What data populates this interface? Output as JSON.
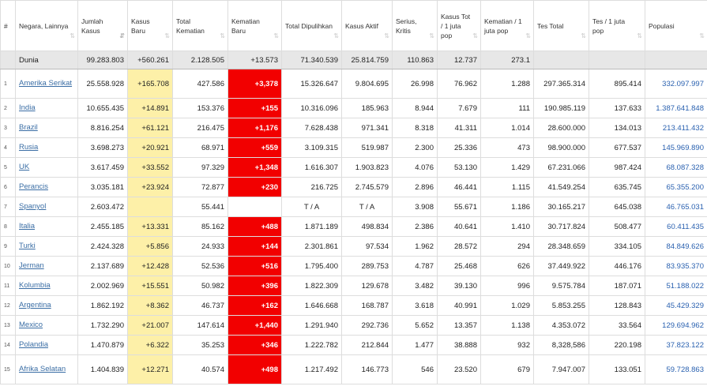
{
  "headers": [
    {
      "label": "#",
      "sort": ""
    },
    {
      "label": "Negara, Lainnya",
      "sort": "⇅"
    },
    {
      "label": "Jumlah Kasus",
      "sort": "⇵"
    },
    {
      "label": "Kasus Baru",
      "sort": "⇅"
    },
    {
      "label": "Total Kematian",
      "sort": "⇅"
    },
    {
      "label": "Kematian Baru",
      "sort": "⇅"
    },
    {
      "label": "Total Dipulihkan",
      "sort": "⇅"
    },
    {
      "label": "Kasus Aktif",
      "sort": "⇅"
    },
    {
      "label": "Serius, Kritis",
      "sort": "⇅"
    },
    {
      "label": "Kasus Tot / 1 juta pop",
      "sort": "⇅"
    },
    {
      "label": "Kematian / 1 juta pop",
      "sort": "⇅"
    },
    {
      "label": "Tes Total",
      "sort": "⇅"
    },
    {
      "label": "Tes / 1 juta pop",
      "sort": "⇅"
    },
    {
      "label": "Populasi",
      "sort": "⇅"
    }
  ],
  "world": [
    "",
    "Dunia",
    "99.283.803",
    "+560.261",
    "2.128.505",
    "+13.573",
    "71.340.539",
    "25.814.759",
    "110.863",
    "12.737",
    "273.1",
    "",
    "",
    ""
  ],
  "rows": [
    [
      "1",
      "Amerika Serikat",
      "25.558.928",
      "+165.708",
      "427.586",
      "+3,378",
      "15.326.647",
      "9.804.695",
      "26.998",
      "76.962",
      "1.288",
      "297.365.314",
      "895.414",
      "332.097.997"
    ],
    [
      "2",
      "India",
      "10.655.435",
      "+14.891",
      "153.376",
      "+155",
      "10.316.096",
      "185.963",
      "8.944",
      "7.679",
      "111",
      "190.985.119",
      "137.633",
      "1.387.641.848"
    ],
    [
      "3",
      "Brazil",
      "8.816.254",
      "+61.121",
      "216.475",
      "+1,176",
      "7.628.438",
      "971.341",
      "8.318",
      "41.311",
      "1.014",
      "28.600.000",
      "134.013",
      "213.411.432"
    ],
    [
      "4",
      "Rusia",
      "3.698.273",
      "+20.921",
      "68.971",
      "+559",
      "3.109.315",
      "519.987",
      "2.300",
      "25.336",
      "473",
      "98.900.000",
      "677.537",
      "145.969.890"
    ],
    [
      "5",
      "UK",
      "3.617.459",
      "+33.552",
      "97.329",
      "+1,348",
      "1.616.307",
      "1.903.823",
      "4.076",
      "53.130",
      "1.429",
      "67.231.066",
      "987.424",
      "68.087.328"
    ],
    [
      "6",
      "Perancis",
      "3.035.181",
      "+23.924",
      "72.877",
      "+230",
      "216.725",
      "2.745.579",
      "2.896",
      "46.441",
      "1.115",
      "41.549.254",
      "635.745",
      "65.355.200"
    ],
    [
      "7",
      "Spanyol",
      "2.603.472",
      "",
      "55.441",
      "",
      "T / A",
      "T / A",
      "3.908",
      "55.671",
      "1.186",
      "30.165.217",
      "645.038",
      "46.765.031"
    ],
    [
      "8",
      "Italia",
      "2.455.185",
      "+13.331",
      "85.162",
      "+488",
      "1.871.189",
      "498.834",
      "2.386",
      "40.641",
      "1.410",
      "30.717.824",
      "508.477",
      "60.411.435"
    ],
    [
      "9",
      "Turki",
      "2.424.328",
      "+5.856",
      "24.933",
      "+144",
      "2.301.861",
      "97.534",
      "1.962",
      "28.572",
      "294",
      "28.348.659",
      "334.105",
      "84.849.626"
    ],
    [
      "10",
      "Jerman",
      "2.137.689",
      "+12.428",
      "52.536",
      "+516",
      "1.795.400",
      "289.753",
      "4.787",
      "25.468",
      "626",
      "37.449.922",
      "446.176",
      "83.935.370"
    ],
    [
      "11",
      "Kolumbia",
      "2.002.969",
      "+15.551",
      "50.982",
      "+396",
      "1.822.309",
      "129.678",
      "3.482",
      "39.130",
      "996",
      "9.575.784",
      "187.071",
      "51.188.022"
    ],
    [
      "12",
      "Argentina",
      "1.862.192",
      "+8.362",
      "46.737",
      "+162",
      "1.646.668",
      "168.787",
      "3.618",
      "40.991",
      "1.029",
      "5.853.255",
      "128.843",
      "45.429.329"
    ],
    [
      "13",
      "Mexico",
      "1.732.290",
      "+21.007",
      "147.614",
      "+1,440",
      "1.291.940",
      "292.736",
      "5.652",
      "13.357",
      "1.138",
      "4.353.072",
      "33.564",
      "129.694.962"
    ],
    [
      "14",
      "Polandia",
      "1.470.879",
      "+6.322",
      "35.253",
      "+346",
      "1.222.782",
      "212.844",
      "1.477",
      "38.888",
      "932",
      "8,328,586",
      "220.198",
      "37.823.122"
    ],
    [
      "15",
      "Afrika Selatan",
      "1.404.839",
      "+12.271",
      "40.574",
      "+498",
      "1.217.492",
      "146.773",
      "546",
      "23.520",
      "679",
      "7.947.007",
      "133.051",
      "59.728.863"
    ]
  ],
  "colors": {
    "new_cases_bg": "#fdf0a8",
    "new_deaths_bg": "#f20000",
    "world_row_bg": "#e7e7e7",
    "link": "#3b6ea5"
  }
}
